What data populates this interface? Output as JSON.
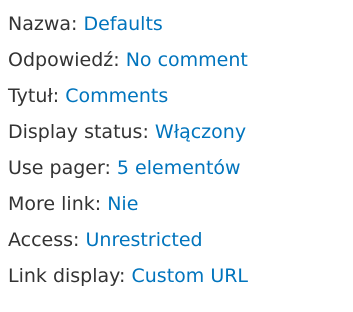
{
  "settings": [
    {
      "label": "Nazwa:",
      "value": "Defaults"
    },
    {
      "label": "Odpowiedź:",
      "value": "No comment"
    },
    {
      "label": "Tytuł:",
      "value": "Comments"
    },
    {
      "label": "Display status:",
      "value": "Włączony"
    },
    {
      "label": "Use pager:",
      "value": "5 elementów"
    },
    {
      "label": "More link:",
      "value": "Nie"
    },
    {
      "label": "Access:",
      "value": "Unrestricted"
    },
    {
      "label": "Link display:",
      "value": "Custom URL"
    }
  ],
  "colors": {
    "label": "#333333",
    "link": "#0074bd",
    "background": "#ffffff"
  }
}
